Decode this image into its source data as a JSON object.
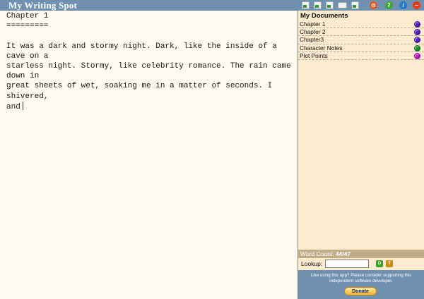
{
  "app": {
    "title": "My Writing Spot"
  },
  "editor": {
    "lines": [
      "Chapter 1",
      "=========",
      "",
      "It was a dark and stormy night. Dark, like the inside of a cave on a",
      "starless night. Stormy, like celebrity romance. The rain came down in",
      "great sheets of wet, soaking me in a matter of seconds. I shivered,",
      "and"
    ]
  },
  "sidebar": {
    "heading": "My Documents",
    "documents": [
      {
        "name": "Chapter 1",
        "color": "#5a1fd0"
      },
      {
        "name": "Chapter 2",
        "color": "#5a1fd0"
      },
      {
        "name": "Chapter3",
        "color": "#5a1fd0"
      },
      {
        "name": "Character Notes",
        "color": "#1c9a2c"
      },
      {
        "name": "Plot Points",
        "color": "#d21ad2"
      }
    ],
    "word_count": {
      "label": "Word Count:",
      "value": "44/47"
    },
    "lookup": {
      "label": "Lookup:",
      "value": "",
      "placeholder": "",
      "btn_d": "D",
      "btn_t": "T"
    },
    "support": {
      "text": "Like using this app? Please consider supporting this independent software developer.",
      "donate_label": "Donate"
    }
  },
  "toolbar": {
    "icons": [
      "new-document-icon",
      "open-document-icon",
      "edit-document-icon",
      "message-icon",
      "save-icon",
      "stop-icon",
      "help-icon",
      "info-icon",
      "close-icon"
    ],
    "colors": {
      "stop": "#e85a1a",
      "help": "#3aa82a",
      "info": "#1e7ad8",
      "close": "#e83a1a"
    }
  },
  "colors": {
    "accent": "#7090b0",
    "sidebar_bg": "#fdebd0",
    "editor_bg": "#fffaf0",
    "wordcount_bg": "#c2ad8a"
  }
}
